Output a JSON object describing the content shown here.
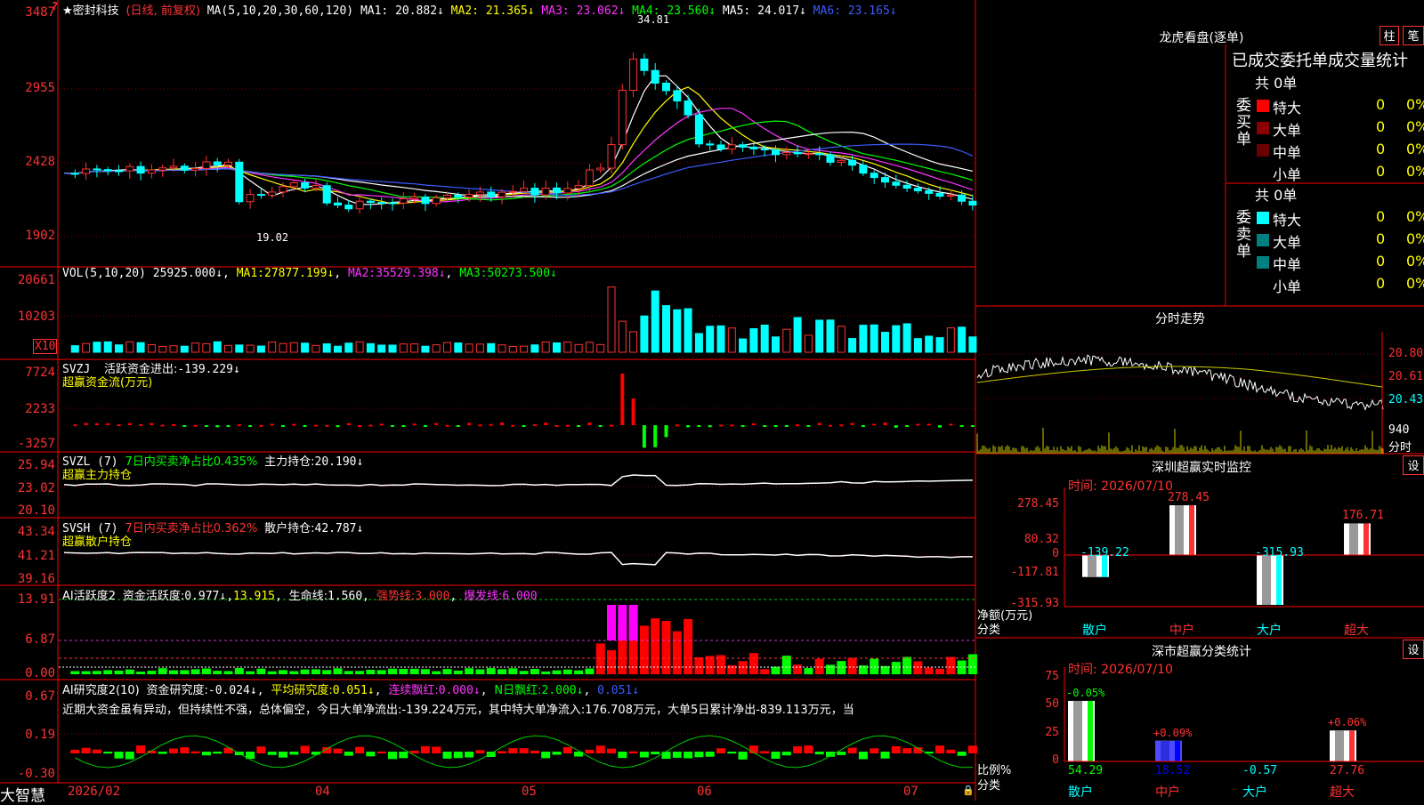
{
  "app": {
    "name": "大智慧"
  },
  "price_chart": {
    "stock_name": "★密封科技",
    "mode_label": "(日线, 前复权)",
    "ma_config": "MA(5,10,20,30,60,120)",
    "ma_readouts": [
      {
        "label": "MA1:",
        "value": "20.882↓",
        "color": "#ffffff"
      },
      {
        "label": "MA2:",
        "value": "21.365↓",
        "color": "#ffff00"
      },
      {
        "label": "MA3:",
        "value": "23.062↓",
        "color": "#ff33ff"
      },
      {
        "label": "MA4:",
        "value": "23.560↓",
        "color": "#00ff00"
      },
      {
        "label": "MA5:",
        "value": "24.017↓",
        "color": "#ffffff"
      },
      {
        "label": "MA6:",
        "value": "23.165↓",
        "color": "#3b5bff"
      }
    ],
    "y_ticks": [
      "3487",
      "2955",
      "2428",
      "1902"
    ],
    "high_label": "34.81",
    "low_label": "19.02"
  },
  "vol_panel": {
    "title": "VOL(5,10,20)",
    "value": "25925.000↓",
    "ma1_label": "MA1:",
    "ma1": "27877.199↓",
    "ma2_label": "MA2:",
    "ma2": "35529.398↓",
    "ma3_label": "MA3:",
    "ma3": "50273.500↓",
    "y_ticks": [
      "20661",
      "10203"
    ],
    "unit": "X10"
  },
  "svzj_panel": {
    "title": "SVZJ",
    "label": "活跃资金进出:",
    "value": "-139.229↓",
    "subtitle": "超赢资金流(万元)",
    "y_ticks": [
      "7724",
      "2233",
      "-3257"
    ]
  },
  "svzl_panel": {
    "title": "SVZL (7)",
    "ratio_text": "7日内买卖净占比0.435%",
    "label": "主力持仓:",
    "value": "20.190↓",
    "subtitle": "超赢主力持仓",
    "y_ticks": [
      "25.94",
      "23.02",
      "20.10"
    ]
  },
  "svsh_panel": {
    "title": "SVSH (7)",
    "ratio_text": "7日内买卖净占比0.362%",
    "label": "散户持仓:",
    "value": "42.787↓",
    "subtitle": "超赢散户持仓",
    "y_ticks": [
      "43.34",
      "41.21",
      "39.16"
    ]
  },
  "ai_active_panel": {
    "title": "AI活跃度2",
    "label": "资金活跃度:",
    "value": "0.977↓",
    "value2": "13.915",
    "life_label": "生命线:",
    "life": "1.560",
    "strong_label": "强势线:",
    "strong": "3.000",
    "burst_label": "爆发线:",
    "burst": "6.000",
    "y_ticks": [
      "13.91",
      "6.87",
      "0.00"
    ]
  },
  "ai_research_panel": {
    "title": "AI研究度2(10)",
    "label": "资金研究度:",
    "value": "-0.024↓",
    "avg_label": "平均研究度:",
    "avg": "0.051↓",
    "lianxu_label": "连续飘红:",
    "lianxu": "0.000↓",
    "nday_label": "N日飘红:",
    "nday": "2.000↓",
    "last": "0.051↓",
    "commentary": "近期大资金虽有异动，但持续性不强，总体偏空，今日大单净流出:-139.224万元，其中特大单净流入:176.708万元，大单5日累计净出-839.113万元，当",
    "y_ticks": [
      "0.67",
      "0.19",
      "-0.30"
    ]
  },
  "x_axis": {
    "labels": [
      "2026/02",
      "04",
      "05",
      "06",
      "07"
    ]
  },
  "longhu": {
    "title": "龙虎看盘(逐单)",
    "btn_zhu": "柱",
    "btn_bi": "笔",
    "header": "已成交委托单成交量统计",
    "buy": {
      "side_label": "委买单",
      "total": "共 0单",
      "rows": [
        {
          "name": "特大",
          "count": "0",
          "pct": "0%",
          "color": "#ff0000"
        },
        {
          "name": "大单",
          "count": "0",
          "pct": "0%",
          "color": "#8b0000"
        },
        {
          "name": "中单",
          "count": "0",
          "pct": "0%",
          "color": "#6b0000"
        },
        {
          "name": "小单",
          "count": "0",
          "pct": "0%",
          "color": "#000000"
        }
      ]
    },
    "sell": {
      "side_label": "委卖单",
      "total": "共 0单",
      "rows": [
        {
          "name": "特大",
          "count": "0",
          "pct": "0%",
          "color": "#00ffff"
        },
        {
          "name": "大单",
          "count": "0",
          "pct": "0%",
          "color": "#008080"
        },
        {
          "name": "中单",
          "count": "0",
          "pct": "0%",
          "color": "#008080"
        },
        {
          "name": "小单",
          "count": "0",
          "pct": "0%",
          "color": "#000000"
        }
      ]
    }
  },
  "intraday": {
    "title": "分时走势",
    "y_ticks": [
      "20.80",
      "20.61",
      "20.43"
    ],
    "vol_tick": "940",
    "vol_label": "分时"
  },
  "monitor": {
    "title": "深圳超赢实时监控",
    "btn": "设",
    "time_label": "时间: 2026/07/10",
    "y_ticks": [
      "278.45",
      "80.32",
      "0",
      "-117.81",
      "-315.93"
    ],
    "axis_caption1": "净额(万元)",
    "axis_caption2": "分类",
    "categories": [
      "散户",
      "中户",
      "大户",
      "超大"
    ],
    "values": [
      -139.22,
      278.45,
      -315.93,
      176.71
    ],
    "value_labels": [
      "-139.22",
      "278.45",
      "-315.93",
      "176.71"
    ],
    "ylim": [
      -315.93,
      278.45
    ]
  },
  "classify": {
    "title": "深市超赢分类统计",
    "btn": "设",
    "time_label": "时间: 2026/07/10",
    "y_ticks": [
      "75",
      "50",
      "25",
      "0"
    ],
    "axis_caption1": "比例%",
    "axis_caption2": "分类",
    "categories": [
      "散户",
      "中户",
      "大户",
      "超大"
    ],
    "values": [
      54.29,
      18.52,
      -0.57,
      27.76
    ],
    "value_labels": [
      "54.29",
      "18.52",
      "-0.57",
      "27.76"
    ],
    "changes": [
      "-0.05%",
      "+0.09%",
      "",
      "+0.06%"
    ],
    "ylim": [
      0,
      75
    ]
  },
  "chart_data": [
    {
      "type": "bar",
      "title": "深圳超赢实时监控",
      "categories": [
        "散户",
        "中户",
        "大户",
        "超大"
      ],
      "values": [
        -139.22,
        278.45,
        -315.93,
        176.71
      ],
      "ylabel": "净额(万元)",
      "xlabel": "分类",
      "ylim": [
        -315.93,
        278.45
      ]
    },
    {
      "type": "bar",
      "title": "深市超赢分类统计",
      "categories": [
        "散户",
        "中户",
        "大户",
        "超大"
      ],
      "values": [
        54.29,
        18.52,
        -0.57,
        27.76
      ],
      "ylabel": "比例%",
      "xlabel": "分类",
      "ylim": [
        0,
        75
      ]
    },
    {
      "type": "line",
      "title": "分时走势",
      "ylim": [
        20.3,
        20.9
      ],
      "y_ticks": [
        20.43,
        20.61,
        20.8
      ]
    }
  ]
}
